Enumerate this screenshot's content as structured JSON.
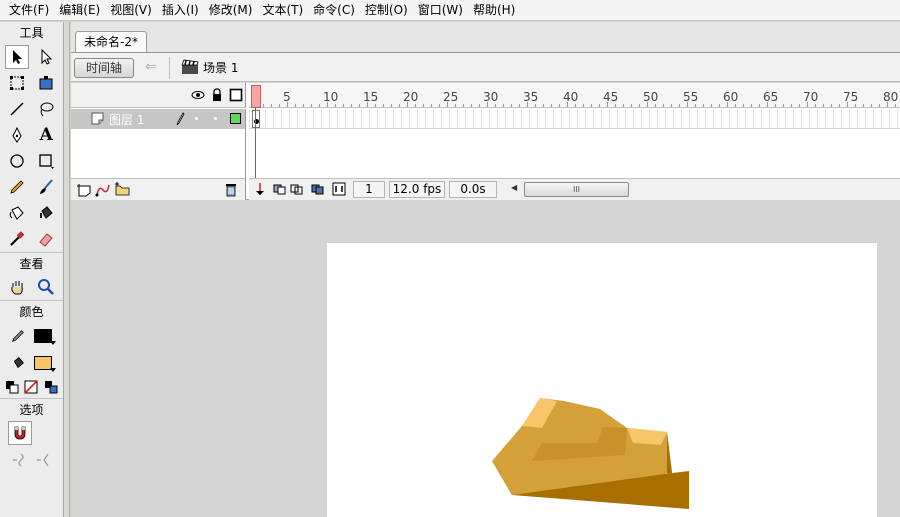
{
  "menu": [
    "文件(F)",
    "编辑(E)",
    "视图(V)",
    "插入(I)",
    "修改(M)",
    "文本(T)",
    "命令(C)",
    "控制(O)",
    "窗口(W)",
    "帮助(H)"
  ],
  "tools": {
    "section_tools": "工具",
    "section_view": "查看",
    "section_color": "颜色",
    "section_options": "选项",
    "text_tool_glyph": "A",
    "stroke_color": "#000000",
    "fill_color": "#f7c66a"
  },
  "document": {
    "tab_title": "未命名-2*",
    "timeline_button": "时间轴",
    "scene_label": "场景 1"
  },
  "timeline": {
    "layer_name": "图层 1",
    "ruler_numbers": [
      "1",
      "5",
      "10",
      "15",
      "20",
      "25",
      "30",
      "35",
      "40",
      "45",
      "50",
      "55",
      "60",
      "65",
      "70",
      "75",
      "80"
    ],
    "current_frame": "1",
    "frame_rate": "12.0 fps",
    "elapsed_time": "0.0s",
    "scroll_grip": "III"
  },
  "colors": {
    "shape_light": "#f7c66a",
    "shape_mid": "#d4a03a",
    "shape_dark": "#a66f00",
    "shape_base": "#c9912a"
  }
}
